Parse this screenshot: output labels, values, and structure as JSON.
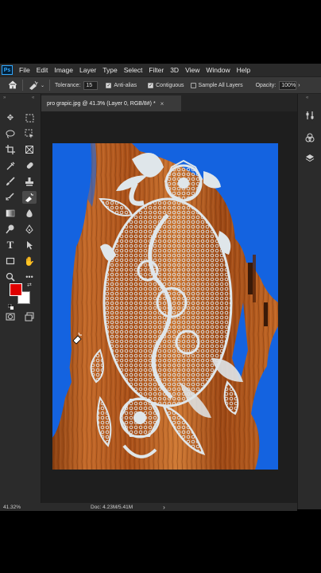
{
  "app": {
    "logo_text": "Ps"
  },
  "menu": [
    "File",
    "Edit",
    "Image",
    "Layer",
    "Type",
    "Select",
    "Filter",
    "3D",
    "View",
    "Window",
    "Help"
  ],
  "options": {
    "tolerance_label": "Tolerance:",
    "tolerance_value": "15",
    "anti_alias_label": "Anti-alias",
    "anti_alias_checked": true,
    "contiguous_label": "Contiguous",
    "contiguous_checked": true,
    "sample_all_label": "Sample All Layers",
    "sample_all_checked": false,
    "opacity_label": "Opacity:",
    "opacity_value": "100%"
  },
  "document": {
    "tab_title": "pro grapic.jpg @ 41.3% (Layer 0, RGB/8#) *",
    "close_glyph": "×"
  },
  "status": {
    "zoom": "41.32%",
    "doc_info": "Doc: 4.23M/5.41M",
    "arrow": "›"
  },
  "tools": {
    "active_tool": "magic-eraser-tool",
    "foreground_color": "#e00000",
    "background_color": "#ffffff"
  },
  "colors": {
    "menubar_bg": "#2a2a2a",
    "panel_bg": "#2b2b2b",
    "canvas_blue": "#1463e0",
    "wood": "#b35a1f",
    "lace": "#dfe6ea"
  }
}
